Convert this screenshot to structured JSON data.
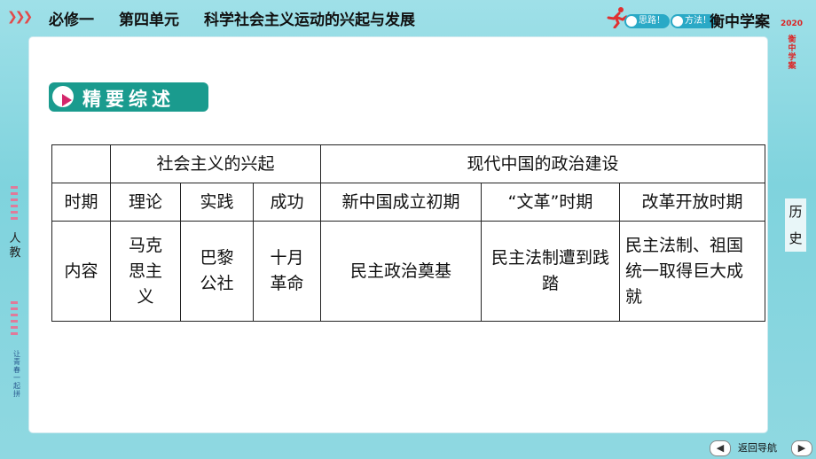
{
  "header": {
    "course": "必修一",
    "unit": "第四单元",
    "topic": "科学社会主义运动的兴起与发展",
    "slogan_1": "思路！",
    "slogan_2": "方法！",
    "brand": "衡中学案",
    "year": "2020"
  },
  "section": {
    "title": "精要综述"
  },
  "table": {
    "group_headers": [
      "社会主义的兴起",
      "现代中国的政治建设"
    ],
    "col_headers": [
      "时期",
      "理论",
      "实践",
      "成功",
      "新中国成立初期",
      "“文革”时期",
      "改革开放时期"
    ],
    "row": [
      "内容",
      "马克思主义",
      "巴黎公社",
      "十月革命",
      "民主政治奠基",
      "民主法制遭到践踏",
      "民主法制、祖国统一取得巨大成就"
    ]
  },
  "sidebar_right": {
    "subject": "历史",
    "vertical_text": "衡中学案"
  },
  "sidebar_left": {
    "edition": "人教",
    "slogan": "让青春一起拼"
  },
  "nav": {
    "back_label": "返回导航"
  },
  "colors": {
    "background": "#7fd3dd",
    "section_bg": "#1a9b8e",
    "play_triangle": "#d4266b",
    "accent_red": "#e24a4a"
  }
}
